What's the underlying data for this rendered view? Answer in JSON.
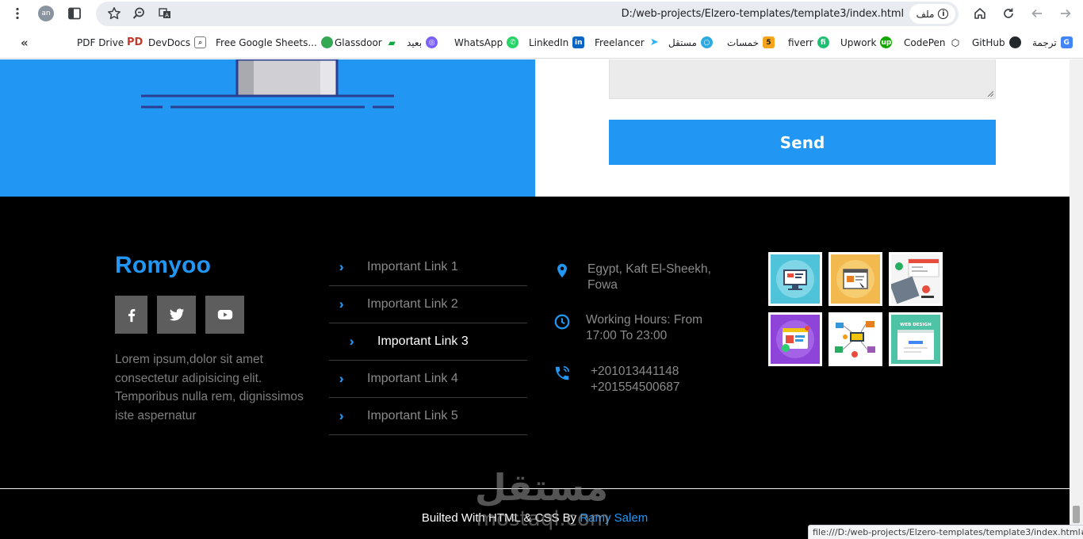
{
  "browser": {
    "avatar_initials": "an",
    "url": "D:/web-projects/Elzero-templates/template3/index.html",
    "site_chip": "ملف",
    "status_url": "file:///D:/web-projects/Elzero-templates/template3/index.html#"
  },
  "bookmarks": [
    {
      "label": "ترجمة",
      "icon": "google-translate-icon",
      "color": "#4285f4"
    },
    {
      "label": "GitHub",
      "icon": "github-icon",
      "color": "#24292e"
    },
    {
      "label": "CodePen",
      "icon": "codepen-icon",
      "color": "#111111"
    },
    {
      "label": "Upwork",
      "icon": "upwork-icon",
      "color": "#14a800"
    },
    {
      "label": "fiverr",
      "icon": "fiverr-icon",
      "color": "#1dbf73"
    },
    {
      "label": "خمسات",
      "icon": "khamsat-icon",
      "color": "#f4a51c"
    },
    {
      "label": "مستقل",
      "icon": "mostaql-icon",
      "color": "#2caae2"
    },
    {
      "label": "Freelancer",
      "icon": "freelancer-icon",
      "color": "#29b2fe"
    },
    {
      "label": "LinkedIn",
      "icon": "linkedin-icon",
      "color": "#0a66c2"
    },
    {
      "label": "WhatsApp",
      "icon": "whatsapp-icon",
      "color": "#25d366"
    },
    {
      "label": "بعيد",
      "icon": "baaeed-icon",
      "color": "#7b61ff"
    },
    {
      "label": "Glassdoor",
      "icon": "glassdoor-icon",
      "color": "#0caa41"
    },
    {
      "label": "Free Google Sheets...",
      "icon": "sheets-icon",
      "color": "#34a853"
    },
    {
      "label": "DevDocs",
      "icon": "devdocs-icon",
      "color": "#555555"
    },
    {
      "label": "PDF Drive",
      "icon": "pdfdrive-icon",
      "color": "#c0392b"
    }
  ],
  "contact_form": {
    "send_label": "Send"
  },
  "footer": {
    "brand": "Romyoo",
    "socials": [
      {
        "name": "facebook-icon"
      },
      {
        "name": "twitter-icon"
      },
      {
        "name": "youtube-icon"
      }
    ],
    "about": "Lorem ipsum,dolor sit amet consectetur adipisicing elit. Temporibus nulla rem, dignissimos iste aspernatur",
    "links": [
      {
        "label": "Important Link 1",
        "active": false
      },
      {
        "label": "Important Link 2",
        "active": false
      },
      {
        "label": "Important Link 3",
        "active": true
      },
      {
        "label": "Important Link 4",
        "active": false
      },
      {
        "label": "Important Link 5",
        "active": false
      }
    ],
    "contact": {
      "address": "Egypt, Kaft El-Sheekh, Fowa",
      "hours": "Working Hours: From 17:00 To 23:00",
      "phones": "+201013441148 +201554500687"
    },
    "gallery": [
      {
        "name": "gallery-image-monitor",
        "bg": "#4fc3d9"
      },
      {
        "name": "gallery-image-browser",
        "bg": "#f2b94e"
      },
      {
        "name": "gallery-image-desk",
        "bg": "#f5f5f5"
      },
      {
        "name": "gallery-image-app",
        "bg": "#8e44d9"
      },
      {
        "name": "gallery-image-network",
        "bg": "#ffffff"
      },
      {
        "name": "gallery-image-webdesign",
        "bg": "#4ec3a6"
      }
    ],
    "gallery_webdesign_caption": "WEB DESIGN"
  },
  "copyright": {
    "prefix": "Builted With HTML & CSS By",
    "author": "Ramy Salem"
  },
  "watermark": {
    "arabic": "مستقل",
    "latin": "mostaql.com"
  },
  "colors": {
    "accent": "#2196f3",
    "footer_bg": "#000000",
    "muted_text": "#8a8a8a"
  }
}
